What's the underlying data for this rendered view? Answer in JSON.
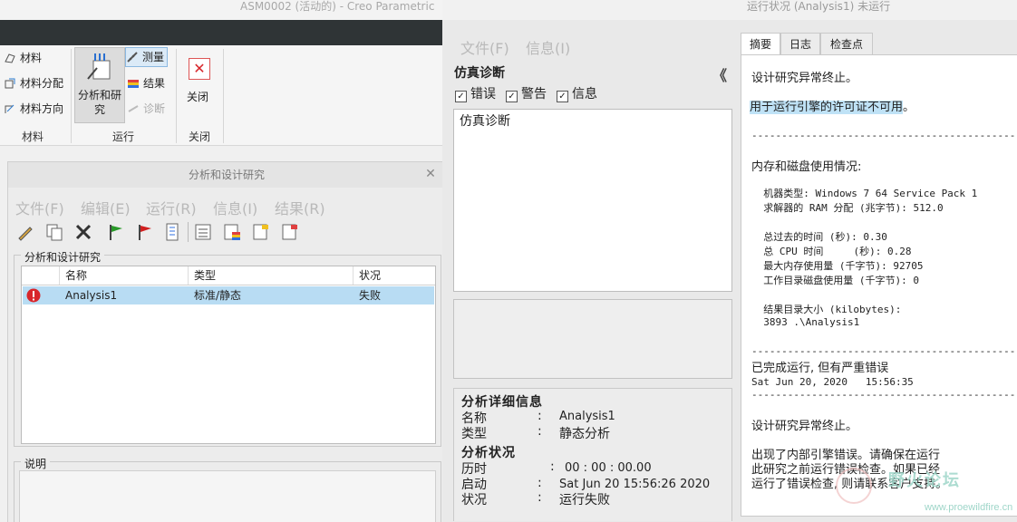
{
  "creo": {
    "title": "ASM0002 (活动的) - Creo Parametric",
    "ribbon": {
      "material_group": {
        "items": [
          "材料",
          "材料分配",
          "材料方向"
        ],
        "label": "材料"
      },
      "run_group": {
        "big_button": "分析和研究",
        "measure": "测量",
        "results": "结果",
        "diagnostics": "诊断",
        "label": "运行"
      },
      "close_group": {
        "button": "关闭",
        "label": "关闭"
      }
    }
  },
  "dialog": {
    "title": "分析和设计研究",
    "menu": [
      "文件(F)",
      "编辑(E)",
      "运行(R)",
      "信息(I)",
      "结果(R)"
    ],
    "group_caption": "分析和设计研究",
    "columns": [
      "名称",
      "类型",
      "状况"
    ],
    "rows": [
      {
        "name": "Analysis1",
        "type": "标准/静态",
        "status": "失败"
      }
    ],
    "description_caption": "说明"
  },
  "runwin": {
    "title": "运行状况 (Analysis1) 未运行",
    "menu": [
      "文件(F)",
      "信息(I)"
    ],
    "diag_title": "仿真诊断",
    "collapse_glyph": "《",
    "filters": {
      "errors": "错误",
      "warnings": "警告",
      "info": "信息"
    },
    "diag_item": "仿真诊断",
    "details": {
      "heading": "分析详细信息",
      "name_label": "名称",
      "name_value": "Analysis1",
      "type_label": "类型",
      "type_value": "静态分析",
      "status_heading": "分析状况",
      "elapsed_label": "历时",
      "elapsed_value": "00 : 00 : 00.00",
      "start_label": "启动",
      "start_value": "Sat Jun 20 15:56:26 2020",
      "state_label": "状况",
      "state_value": "运行失败",
      "colon": ":"
    },
    "tabs": [
      "摘要",
      "日志",
      "检查点"
    ],
    "log": {
      "l1": "设计研究异常终止。",
      "l2": "用于运行引擎的许可证不可用",
      "l2_end": "。",
      "sep1": "------------------------------------------------------",
      "l3": "内存和磁盘使用情况:",
      "l4": "  机器类型: Windows 7 64 Service Pack 1",
      "l5": "  求解器的 RAM 分配 (兆字节): 512.0",
      "l6": "  总过去的时间 (秒): 0.30",
      "l7": "  总 CPU 时间     (秒): 0.28",
      "l8": "  最大内存使用量 (千字节): 92705",
      "l9": "  工作目录磁盘使用量 (千字节): 0",
      "l10": "  结果目录大小 (kilobytes):",
      "l11": "  3893 .\\Analysis1",
      "sep2": "------------------------------------------------------",
      "l12": "已完成运行, 但有严重错误",
      "l13": "Sat Jun 20, 2020   15:56:35",
      "sep3": "------------------------------------------------------",
      "l14": "设计研究异常终止。",
      "l15": "出现了内部引擎错误。请确保在运行",
      "l16": "此研究之前运行错误检查。如果已经",
      "l17": "运行了错误检查, 则请联系客户支持。"
    }
  },
  "watermark": {
    "text": "野火论坛",
    "url": "www.proewildfire.cn"
  },
  "colors": {
    "selection": "#b8dcf3",
    "error_icon": "#d8262b",
    "highlight": "#bfe2f6"
  },
  "icons": [
    "material-icon",
    "analysis-study-icon",
    "measure-icon",
    "results-icon",
    "diagnostics-icon",
    "close-red-x-icon",
    "error-status-icon"
  ]
}
